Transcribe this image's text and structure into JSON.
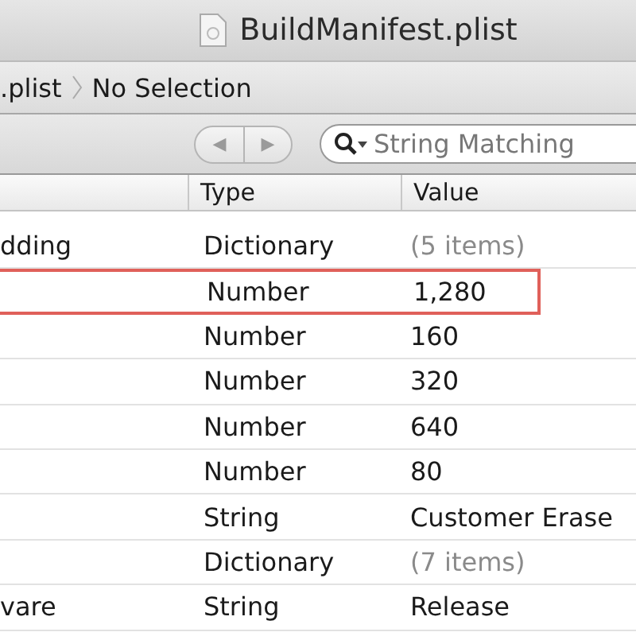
{
  "window": {
    "title": "BuildManifest.plist"
  },
  "breadcrumb": [
    ".plist",
    "No Selection"
  ],
  "toolbar": {
    "back": "◀",
    "forward": "▶",
    "search": {
      "placeholder": "String Matching"
    }
  },
  "table": {
    "columns": [
      "Type",
      "Value"
    ],
    "rows": [
      {
        "key": "dding",
        "type": "Dictionary",
        "value": "(5 items)",
        "muted": true,
        "highlighted": false
      },
      {
        "key": "",
        "type": "Number",
        "value": "1,280",
        "muted": false,
        "highlighted": true
      },
      {
        "key": "",
        "type": "Number",
        "value": "160",
        "muted": false,
        "highlighted": false
      },
      {
        "key": "",
        "type": "Number",
        "value": "320",
        "muted": false,
        "highlighted": false
      },
      {
        "key": "",
        "type": "Number",
        "value": "640",
        "muted": false,
        "highlighted": false
      },
      {
        "key": "",
        "type": "Number",
        "value": "80",
        "muted": false,
        "highlighted": false
      },
      {
        "key": "",
        "type": "String",
        "value": "Customer Erase",
        "muted": false,
        "highlighted": false
      },
      {
        "key": "",
        "type": "Dictionary",
        "value": "(7 items)",
        "muted": true,
        "highlighted": false
      },
      {
        "key": "vare",
        "type": "String",
        "value": "Release",
        "muted": false,
        "highlighted": false
      }
    ]
  }
}
